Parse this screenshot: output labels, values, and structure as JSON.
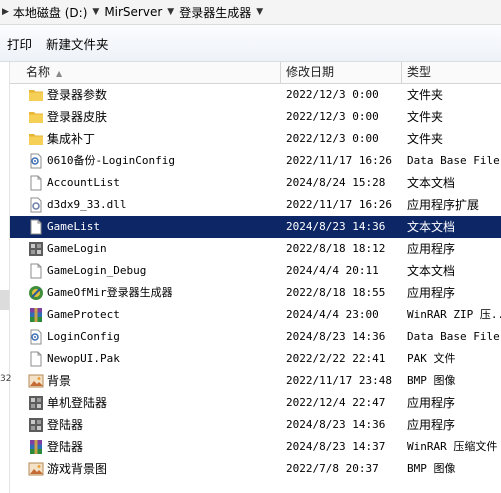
{
  "address": {
    "crumbs": [
      "本地磁盘 (D:)",
      "MirServer",
      "登录器生成器"
    ]
  },
  "toolbar": {
    "print_label": "打印",
    "new_folder_label": "新建文件夹"
  },
  "header": {
    "name": "名称",
    "date": "修改日期",
    "type": "类型"
  },
  "files": [
    {
      "name": "登录器参数",
      "date": "2022/12/3 0:00",
      "type": "文件夹",
      "icon": "folder-icon"
    },
    {
      "name": "登录器皮肤",
      "date": "2022/12/3 0:00",
      "type": "文件夹",
      "icon": "folder-icon"
    },
    {
      "name": "集成补丁",
      "date": "2022/12/3 0:00",
      "type": "文件夹",
      "icon": "folder-icon"
    },
    {
      "name": "0610备份-LoginConfig",
      "date": "2022/11/17 16:26",
      "type": "Data Base File",
      "icon": "config-file-icon"
    },
    {
      "name": "AccountList",
      "date": "2024/8/24 15:28",
      "type": "文本文档",
      "icon": "text-file-icon"
    },
    {
      "name": "d3dx9_33.dll",
      "date": "2022/11/17 16:26",
      "type": "应用程序扩展",
      "icon": "dll-file-icon"
    },
    {
      "name": "GameList",
      "date": "2024/8/23 14:36",
      "type": "文本文档",
      "icon": "text-file-icon"
    },
    {
      "name": "GameLogin",
      "date": "2022/8/18 18:12",
      "type": "应用程序",
      "icon": "app-grid-icon"
    },
    {
      "name": "GameLogin_Debug",
      "date": "2024/4/4 20:11",
      "type": "文本文档",
      "icon": "text-file-icon"
    },
    {
      "name": "GameOfMir登录器生成器",
      "date": "2022/8/18 18:55",
      "type": "应用程序",
      "icon": "mir-app-icon"
    },
    {
      "name": "GameProtect",
      "date": "2024/4/4 23:00",
      "type": "WinRAR ZIP 压...",
      "icon": "winrar-icon"
    },
    {
      "name": "LoginConfig",
      "date": "2024/8/23 14:36",
      "type": "Data Base File",
      "icon": "config-file-icon"
    },
    {
      "name": "NewopUI.Pak",
      "date": "2022/2/22 22:41",
      "type": "PAK 文件",
      "icon": "blank-file-icon"
    },
    {
      "name": "背景",
      "date": "2022/11/17 23:48",
      "type": "BMP 图像",
      "icon": "bmp-image-icon"
    },
    {
      "name": "单机登陆器",
      "date": "2022/12/4 22:47",
      "type": "应用程序",
      "icon": "app-grid-icon"
    },
    {
      "name": "登陆器",
      "date": "2024/8/23 14:36",
      "type": "应用程序",
      "icon": "app-grid-icon"
    },
    {
      "name": "登陆器",
      "date": "2024/8/23 14:37",
      "type": "WinRAR 压缩文件",
      "icon": "winrar-icon"
    },
    {
      "name": "游戏背景图",
      "date": "2022/7/8 20:37",
      "type": "BMP 图像",
      "icon": "bmp-image-icon"
    }
  ],
  "selected_index": 6,
  "colors": {
    "selection": "#0d2666",
    "folder": "#f2c94c"
  }
}
